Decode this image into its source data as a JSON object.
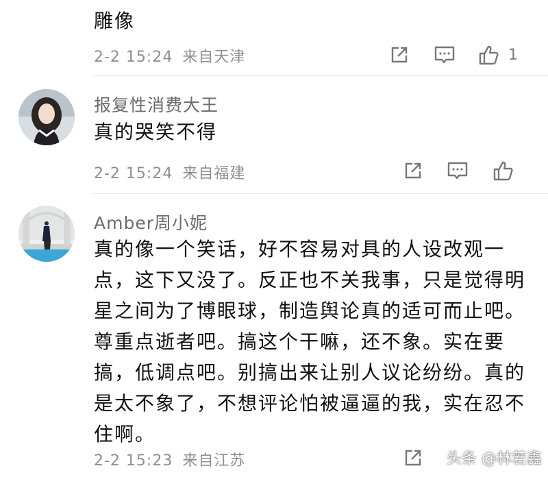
{
  "comments": [
    {
      "text": "雕像",
      "time": "2-2 15:24",
      "location": "来自天津",
      "like_count": "1"
    },
    {
      "author": "报复性消费大王",
      "text": "真的哭笑不得",
      "time": "2-2 15:24",
      "location": "来自福建"
    },
    {
      "author": "Amber周小妮",
      "text_lines": [
        "真的像一个笑话，好不容易对具的人设改观一",
        "点，这下又没了。反正也不关我事，只是觉得明",
        "星之间为了博眼球，制造舆论真的适可而止吧。",
        "尊重点逝者吧。搞这个干嘛，还不象。实在要",
        "搞，低调点吧。别搞出来让别人议论纷纷。真的",
        "是太不象了，不想评论怕被逼逼的我，实在忍不",
        "住啊。"
      ],
      "time": "2-2 15:23",
      "location": "来自江苏"
    }
  ],
  "watermark": "头条 @林若鑫",
  "icons": {
    "share": "share-icon",
    "reply": "comment-icon",
    "like": "thumbs-up-icon"
  }
}
